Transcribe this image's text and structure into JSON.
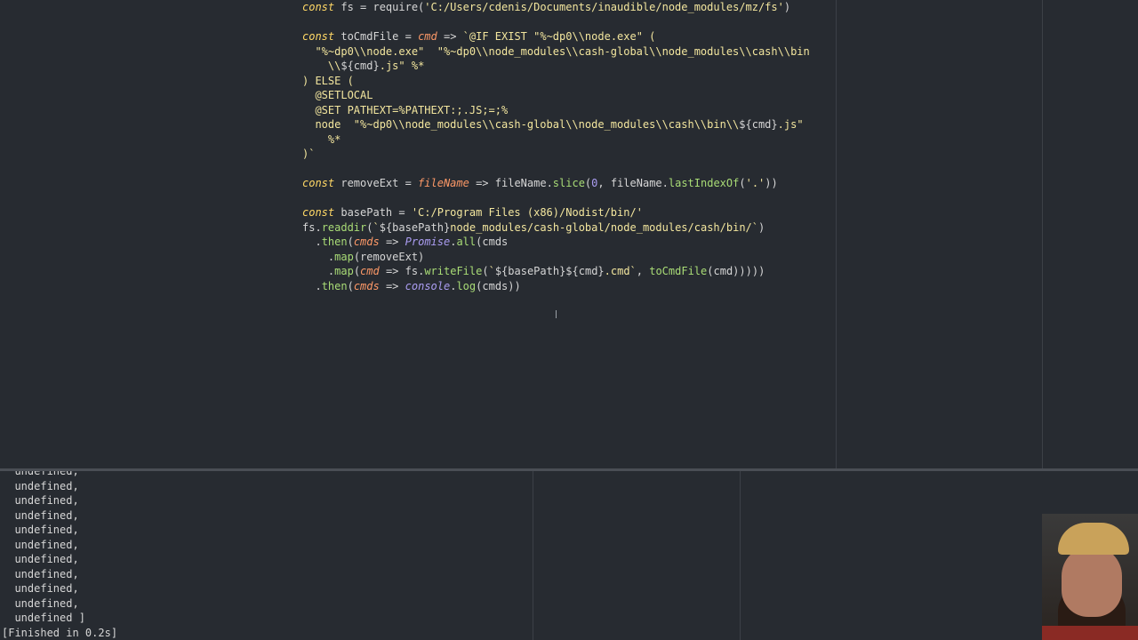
{
  "editor": {
    "lines": [
      [
        [
          "kw",
          "const"
        ],
        [
          "fn",
          " fs "
        ],
        [
          "op",
          "= "
        ],
        [
          "fn",
          "require("
        ],
        [
          "str",
          "'C:/Users/cdenis/Documents/inaudible/node_modules/mz/fs'"
        ],
        [
          "fn",
          ")"
        ]
      ],
      [],
      [
        [
          "kw",
          "const"
        ],
        [
          "fn",
          " toCmdFile "
        ],
        [
          "op",
          "= "
        ],
        [
          "param",
          "cmd"
        ],
        [
          "op",
          " => "
        ],
        [
          "tmpl",
          "`@IF EXIST \"%~dp0\\\\node.exe\" ("
        ]
      ],
      [
        [
          "tmpl",
          "  \"%~dp0\\\\node.exe\"  \"%~dp0\\\\node_modules\\\\cash-global\\\\node_modules\\\\cash\\\\bin"
        ]
      ],
      [
        [
          "tmpl",
          "    \\\\"
        ],
        [
          "interp",
          "${cmd}"
        ],
        [
          "tmpl",
          ".js\" %*"
        ]
      ],
      [
        [
          "tmpl",
          ") ELSE ("
        ]
      ],
      [
        [
          "tmpl",
          "  @SETLOCAL"
        ]
      ],
      [
        [
          "tmpl",
          "  @SET PATHEXT=%PATHEXT:;.JS;=;%"
        ]
      ],
      [
        [
          "tmpl",
          "  node  \"%~dp0\\\\node_modules\\\\cash-global\\\\node_modules\\\\cash\\\\bin\\\\"
        ],
        [
          "interp",
          "${cmd}"
        ],
        [
          "tmpl",
          ".js\""
        ]
      ],
      [
        [
          "tmpl",
          "    %*"
        ]
      ],
      [
        [
          "tmpl",
          ")`"
        ]
      ],
      [],
      [
        [
          "kw",
          "const"
        ],
        [
          "fn",
          " removeExt "
        ],
        [
          "op",
          "= "
        ],
        [
          "param",
          "fileName"
        ],
        [
          "op",
          " => "
        ],
        [
          "fn",
          "fileName."
        ],
        [
          "call",
          "slice"
        ],
        [
          "fn",
          "("
        ],
        [
          "num",
          "0"
        ],
        [
          "fn",
          ", fileName."
        ],
        [
          "call",
          "lastIndexOf"
        ],
        [
          "fn",
          "("
        ],
        [
          "str",
          "'.'"
        ],
        [
          "fn",
          "))"
        ]
      ],
      [],
      [
        [
          "kw",
          "const"
        ],
        [
          "fn",
          " basePath "
        ],
        [
          "op",
          "= "
        ],
        [
          "str",
          "'C:/Program Files (x86)/Nodist/bin/'"
        ]
      ],
      [
        [
          "fn",
          "fs."
        ],
        [
          "call",
          "readdir"
        ],
        [
          "fn",
          "("
        ],
        [
          "tmpl",
          "`"
        ],
        [
          "interp",
          "${basePath}"
        ],
        [
          "tmpl",
          "node_modules/cash-global/node_modules/cash/bin/`"
        ],
        [
          "fn",
          ")"
        ]
      ],
      [
        [
          "fn",
          "  ."
        ],
        [
          "call",
          "then"
        ],
        [
          "fn",
          "("
        ],
        [
          "param",
          "cmds"
        ],
        [
          "op",
          " => "
        ],
        [
          "it",
          "Promise"
        ],
        [
          "fn",
          "."
        ],
        [
          "call",
          "all"
        ],
        [
          "fn",
          "(cmds"
        ]
      ],
      [
        [
          "fn",
          "    ."
        ],
        [
          "call",
          "map"
        ],
        [
          "fn",
          "(removeExt)"
        ]
      ],
      [
        [
          "fn",
          "    ."
        ],
        [
          "call",
          "map"
        ],
        [
          "fn",
          "("
        ],
        [
          "param",
          "cmd"
        ],
        [
          "op",
          " => "
        ],
        [
          "fn",
          "fs."
        ],
        [
          "call",
          "writeFile"
        ],
        [
          "fn",
          "("
        ],
        [
          "tmpl",
          "`"
        ],
        [
          "interp",
          "${basePath}${cmd}"
        ],
        [
          "tmpl",
          ".cmd`"
        ],
        [
          "fn",
          ", "
        ],
        [
          "call",
          "toCmdFile"
        ],
        [
          "fn",
          "(cmd)))))"
        ]
      ],
      [
        [
          "fn",
          "  ."
        ],
        [
          "call",
          "then"
        ],
        [
          "fn",
          "("
        ],
        [
          "param",
          "cmds"
        ],
        [
          "op",
          " => "
        ],
        [
          "it",
          "console"
        ],
        [
          "fn",
          "."
        ],
        [
          "call",
          "log"
        ],
        [
          "fn",
          "(cmds))"
        ]
      ]
    ]
  },
  "output": {
    "lines": [
      "  undefined,",
      "  undefined,",
      "  undefined,",
      "  undefined,",
      "  undefined,",
      "  undefined,",
      "  undefined,",
      "  undefined,",
      "  undefined,",
      "  undefined,",
      "  undefined ]",
      "[Finished in 0.2s]"
    ]
  },
  "colors": {
    "background": "#272b31",
    "keyword": "#ffd866",
    "string": "#f3e69e",
    "function_call": "#a9dc76",
    "parameter": "#fc9867"
  }
}
